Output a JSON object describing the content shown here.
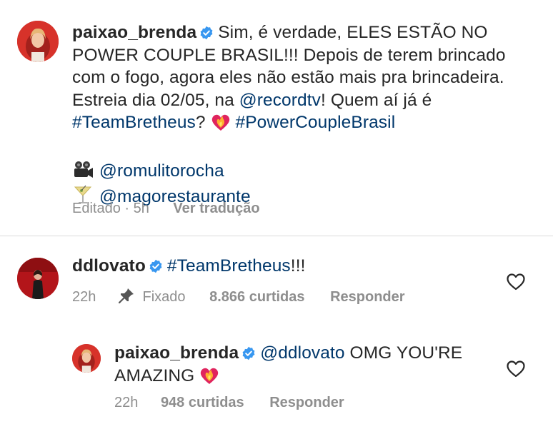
{
  "comment1": {
    "username": "paixao_brenda",
    "text_part1": "Sim, é verdade, ELES ESTÃO NO POWER COUPLE BRASIL!!! Depois de terem brincado com o fogo, agora eles não estão mais pra brincadeira. Estreia dia 02/05, na ",
    "mention_record": "@recordtv",
    "text_part2": "! Quem aí já é ",
    "hashtag_team": "#TeamBretheus",
    "text_part3": "? ",
    "hashtag_power": "#PowerCoupleBrasil",
    "credit1_icon": "movie-camera-icon",
    "credit1_handle": "@romulitorocha",
    "credit2_icon": "cocktail-glass-icon",
    "credit2_handle": "@magorestaurante",
    "edited_label": "Editado · 5h",
    "translate_label": "Ver tradução"
  },
  "comment2": {
    "username": "ddlovato",
    "hashtag": "#TeamBretheus",
    "text_suffix": "!!!",
    "time": "22h",
    "pinned_label": "Fixado",
    "likes": "8.866 curtidas",
    "reply_label": "Responder"
  },
  "reply1": {
    "username": "paixao_brenda",
    "mention": "@ddlovato",
    "text": " OMG YOU'RE AMAZING ",
    "time": "22h",
    "likes": "948 curtidas",
    "reply_label": "Responder"
  },
  "colors": {
    "verified_blue": "#3897f0",
    "link_blue": "#00376b",
    "meta_gray": "#8e8e8e",
    "heart_emoji_red": "#e0245e"
  }
}
